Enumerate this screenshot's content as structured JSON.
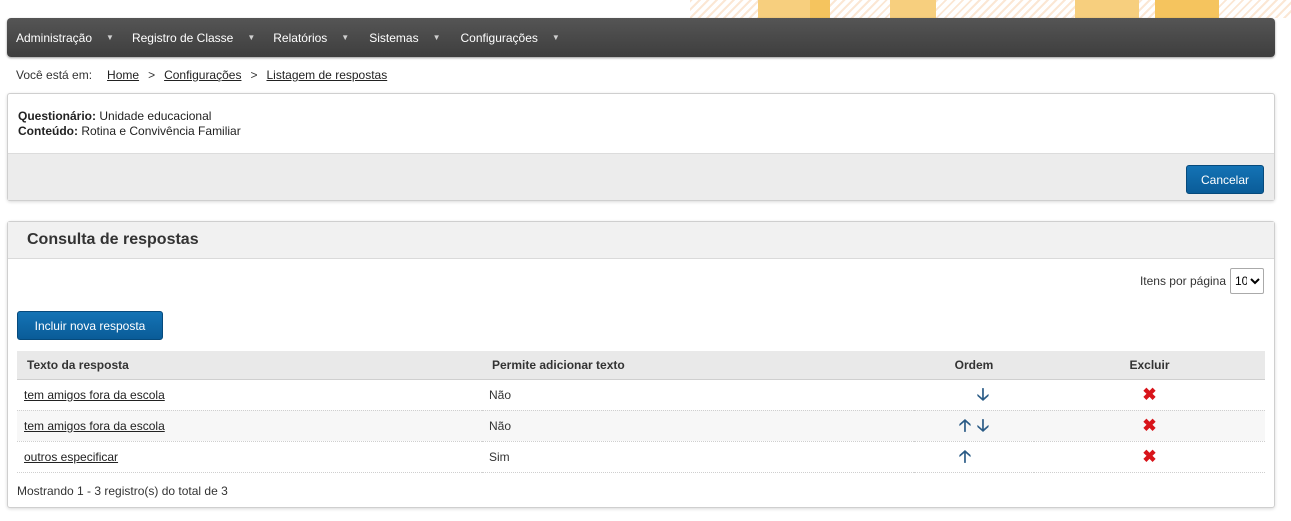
{
  "nav": {
    "items": [
      {
        "label": "Administração"
      },
      {
        "label": "Registro de Classe"
      },
      {
        "label": "Relatórios"
      },
      {
        "label": "Sistemas"
      },
      {
        "label": "Configurações"
      }
    ],
    "caret": "▼"
  },
  "breadcrumb": {
    "prefix": "Você está em:",
    "items": [
      "Home",
      "Configurações",
      "Listagem de respostas"
    ],
    "separator": ">"
  },
  "info": {
    "questionario_label": "Questionário:",
    "questionario_value": "Unidade educacional",
    "conteudo_label": "Conteúdo:",
    "conteudo_value": "Rotina e Convivência Familiar"
  },
  "actions": {
    "cancel_label": "Cancelar"
  },
  "results": {
    "title": "Consulta de respostas",
    "per_page_label": "Itens por página",
    "per_page_value": "10",
    "add_label": "Incluir nova resposta",
    "columns": [
      "Texto da resposta",
      "Permite adicionar texto",
      "Ordem",
      "Excluir"
    ],
    "rows": [
      {
        "text": "tem amigos fora da escola",
        "allow": "Não",
        "up": false,
        "down": true
      },
      {
        "text": "tem amigos fora da escola",
        "allow": "Não",
        "up": true,
        "down": true
      },
      {
        "text": "outros especificar",
        "allow": "Sim",
        "up": true,
        "down": false
      }
    ],
    "footer": "Mostrando 1 - 3 registro(s) do total de 3"
  },
  "icons": {
    "up": "🡡",
    "down": "🡣",
    "delete": "✖",
    "colors": {
      "arrow": "#2a5b86",
      "delete": "#d8141a",
      "primary": "#0f68a9"
    }
  }
}
